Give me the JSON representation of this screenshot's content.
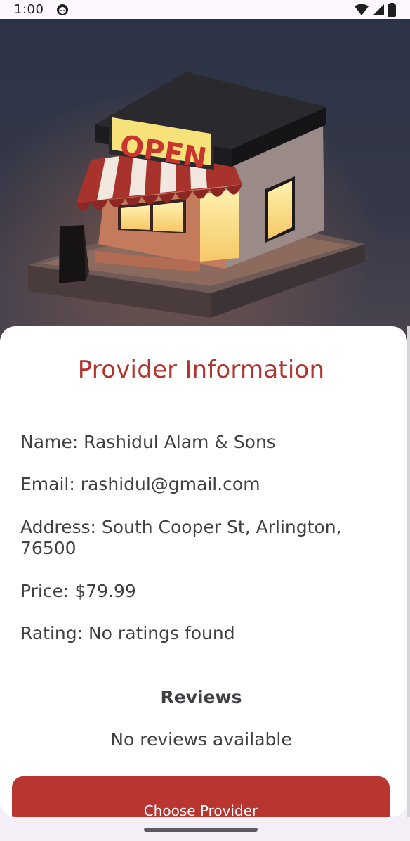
{
  "status_bar": {
    "time": "1:00",
    "notif_icon": "face-icon",
    "wifi_icon": "wifi-icon",
    "signal_icon": "signal-icon",
    "battery_icon": "battery-icon"
  },
  "hero": {
    "sign_text": "OPEN",
    "image": "store-illustration"
  },
  "provider": {
    "title": "Provider Information",
    "name": "Name: Rashidul Alam & Sons",
    "email": "Email: rashidul@gmail.com",
    "address_line1": "Address: South Cooper St, Arlington,",
    "address_line2": "76500",
    "price": "Price: $79.99",
    "rating": "Rating: No ratings found"
  },
  "reviews": {
    "heading": "Reviews",
    "empty_text": "No reviews available"
  },
  "actions": {
    "choose_label": "Choose Provider"
  },
  "colors": {
    "accent": "#b3342f",
    "button": "#b93530",
    "text": "#404044"
  }
}
